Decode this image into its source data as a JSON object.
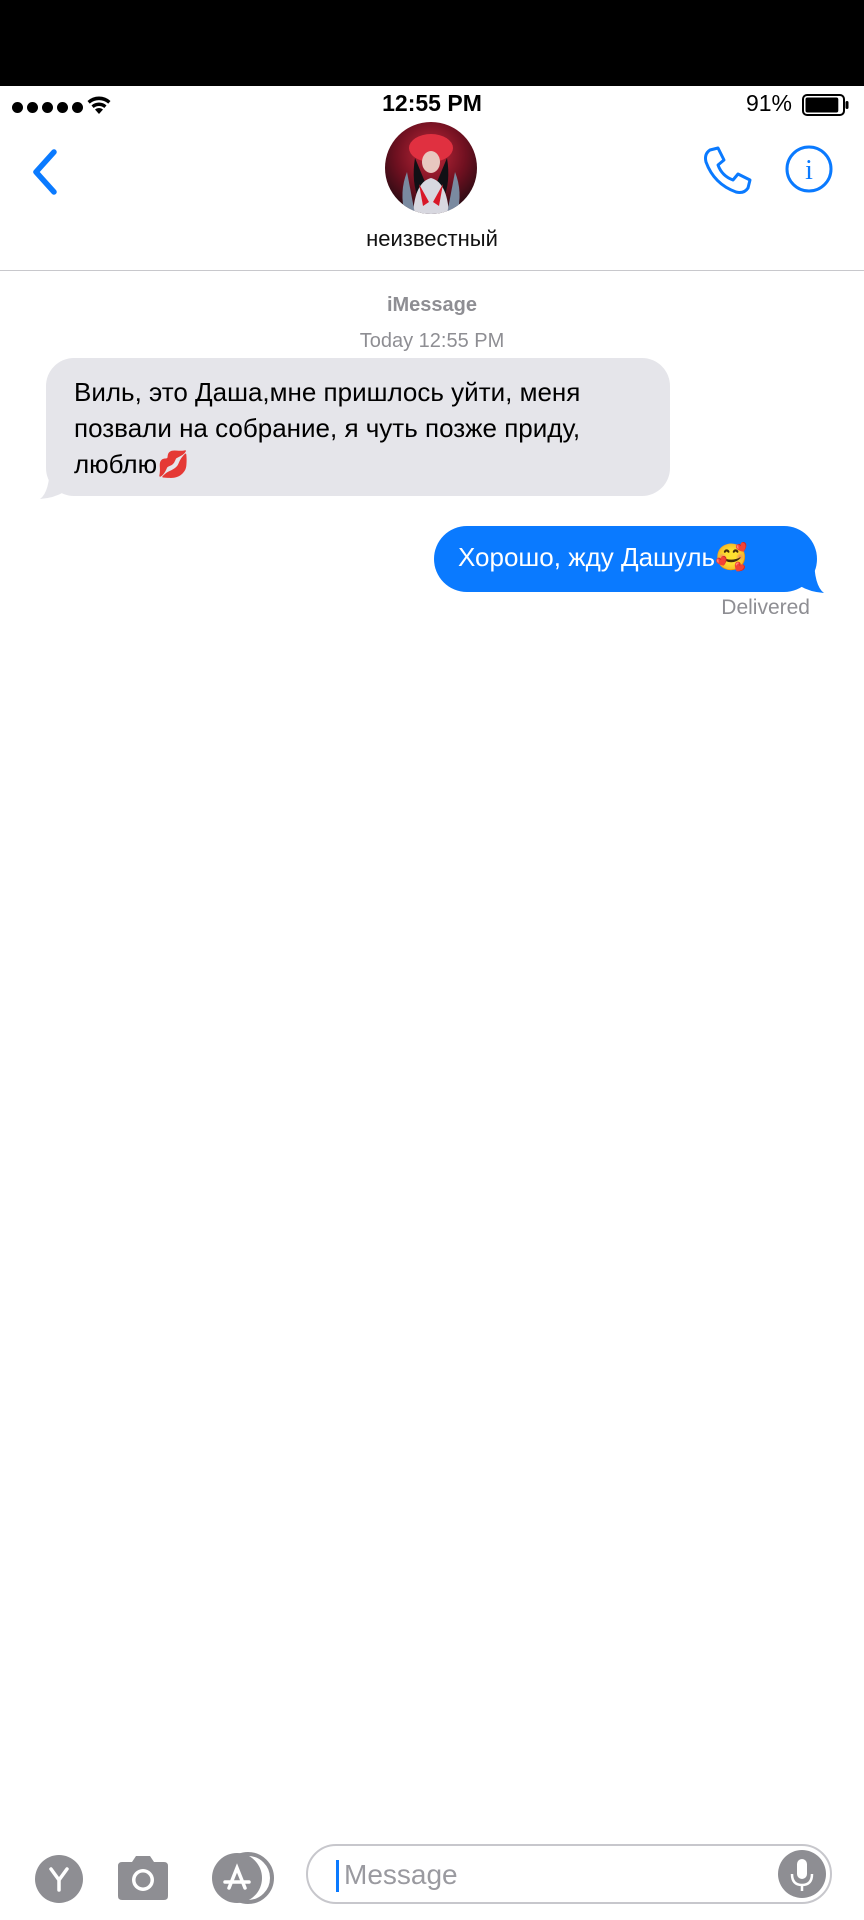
{
  "status_bar": {
    "time": "12:55 PM",
    "battery_percent": "91%",
    "battery_level": 0.91,
    "signal_bars": 5
  },
  "header": {
    "contact_name": "неизвестный",
    "icons": [
      "chevron-left-icon",
      "avatar",
      "phone-icon",
      "info-icon"
    ]
  },
  "conversation": {
    "service": "iMessage",
    "timestamp": "Today 12:55 PM",
    "messages": [
      {
        "direction": "incoming",
        "text": "Виль, это Даша,мне пришлось уйти, меня позвали на собрание, я чуть позже приду, люблю",
        "emoji": "💋"
      },
      {
        "direction": "outgoing",
        "text": "Хорошо, жду Дашуль",
        "emoji": "🥰",
        "status": "Delivered"
      }
    ]
  },
  "input_bar": {
    "placeholder": "Message",
    "icons": [
      "memoji-apps-icon",
      "camera-icon",
      "app-store-icon",
      "microphone-icon"
    ]
  },
  "colors": {
    "accent": "#0a7aff",
    "incoming_bubble": "#e5e5ea",
    "secondary_text": "#8e8e93"
  }
}
